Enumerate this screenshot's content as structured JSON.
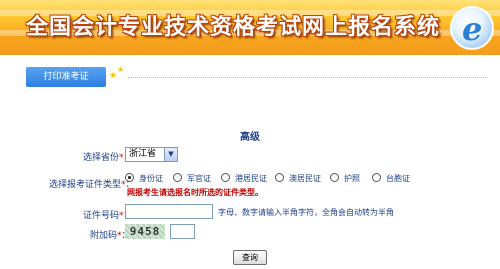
{
  "banner": {
    "title": "全国会计专业技术资格考试网上报名系统",
    "logo_letter": "e"
  },
  "tab": {
    "label": "打印准考证"
  },
  "section": {
    "title": "高级"
  },
  "form": {
    "province_label": "选择省份",
    "province_value": "浙江省",
    "id_type_label": "选择报考证件类型",
    "id_types": [
      "身份证",
      "军官证",
      "港居民证",
      "澳居民证",
      "护照",
      "台胞证"
    ],
    "id_type_selected_index": 0,
    "id_type_warning": "网报考生请选报名时所选的证件类型。",
    "id_number_label": "证件号码",
    "id_number_value": "",
    "id_number_hint": "字母、数字请输入半角字符，全角会自动转为半角",
    "captcha_label": "附加码",
    "captcha_text": "9458",
    "captcha_value": "",
    "required_mark": "*",
    "colon": "："
  },
  "buttons": {
    "query": "查询"
  },
  "colors": {
    "banner_orange": "#f7a51e",
    "tab_blue": "#2c7fe0",
    "label_blue": "#1f3f8a",
    "warning_red": "#c00000"
  }
}
